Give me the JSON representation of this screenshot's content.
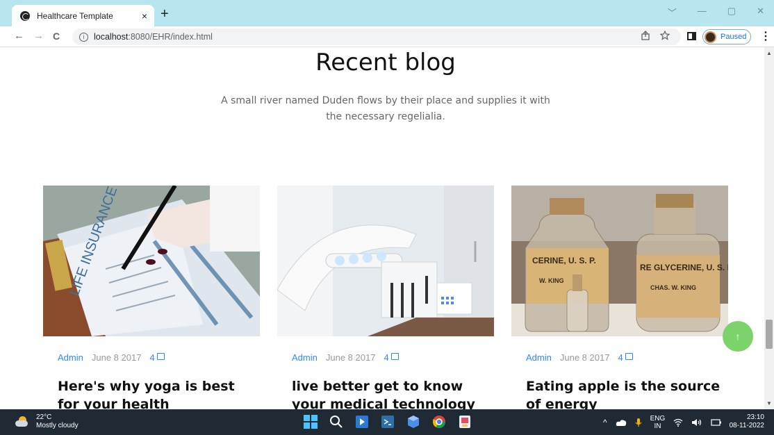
{
  "browser": {
    "tab_title": "Healthcare Template",
    "tab_close": "×",
    "new_tab": "+",
    "url_host": "localhost",
    "url_rest": ":8080/EHR/index.html",
    "profile_label": "Paused",
    "back": "←",
    "forward": "→",
    "reload": "C",
    "info": "i",
    "menu": "⋮",
    "win_chevron": "﹀",
    "win_min": "—",
    "win_restore": "▢",
    "win_close": "✕"
  },
  "section": {
    "heading": "Recent blog",
    "subtitle": "A small river named Duden flows by their place and supplies it with the necessary regelialia."
  },
  "posts": [
    {
      "author": "Admin",
      "date": "June 8 2017",
      "comments": "4",
      "title": "Here's why yoga is best for your health"
    },
    {
      "author": "Admin",
      "date": "June 8 2017",
      "comments": "4",
      "title": "live better get to know your medical technology"
    },
    {
      "author": "Admin",
      "date": "June 8 2017",
      "comments": "4",
      "title": "Eating apple is the source of energy"
    }
  ],
  "fab_icon": "↑",
  "taskbar": {
    "temperature": "22°C",
    "weather": "Mostly cloudy",
    "lang_line1": "ENG",
    "lang_line2": "IN",
    "time": "23:10",
    "date": "08-11-2022"
  },
  "colors": {
    "accent": "#2f89fc",
    "fab": "#7dd36b",
    "chrome_frame": "#b7e5f0",
    "taskbar": "#1f2a35"
  }
}
